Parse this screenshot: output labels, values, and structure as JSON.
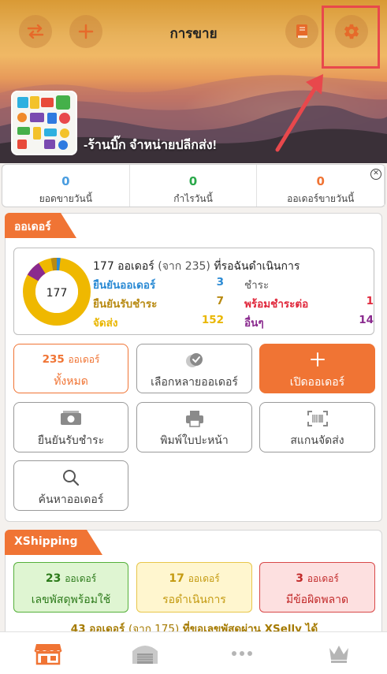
{
  "header": {
    "title": "การขาย",
    "store_name": "-ร้านบิ๊ก จำหน่ายปลีกส่ง!",
    "icons": [
      "swap-arrows-icon",
      "plus-icon",
      "book-icon",
      "gear-icon"
    ]
  },
  "stats": [
    {
      "value": "0",
      "label": "ยอดขายวันนี้",
      "color": "#4a9de0"
    },
    {
      "value": "0",
      "label": "กำไรวันนี้",
      "color": "#2aa84a"
    },
    {
      "value": "0",
      "label": "ออเดอร์ขายวันนี้",
      "color": "#f07434"
    }
  ],
  "orders": {
    "tab_label": "ออเดอร์",
    "donut_center": "177",
    "summary_count": "177 ออเดอร์",
    "summary_total": "(จาก 235)",
    "summary_suffix": "ที่รอฉันดำเนินการ",
    "rows": [
      {
        "label": "ยืนยันออเดอร์",
        "value": "3",
        "color": "#2a8ad4"
      },
      {
        "label": "ยืนยันรับชำระ",
        "value": "7",
        "color": "#b88a12"
      },
      {
        "label": "จัดส่ง",
        "value": "152",
        "color": "#e9b600"
      },
      {
        "label": "ชำระ",
        "value": "",
        "color": "#555555"
      },
      {
        "label": "พร้อมชำระต่อ",
        "value": "1",
        "color": "#e0283c"
      },
      {
        "label": "อื่นๆ",
        "value": "14",
        "color": "#8a2a8e"
      }
    ],
    "all_count": "235",
    "all_unit": "ออเดอร์",
    "all_label": "ทั้งหมด",
    "select_multi": "เลือกหลายออเดอร์",
    "open_order": "เปิดออเดอร์",
    "confirm_payment": "ยืนยันรับชำระ",
    "print_label": "พิมพ์ใบปะหน้า",
    "scan_label": "สแกนจัดส่ง",
    "search_label": "ค้นหาออเดอร์"
  },
  "xshipping": {
    "tab_label": "XShipping",
    "boxes": [
      {
        "count": "23",
        "unit": "ออเดอร์",
        "label": "เลขพัสดุพร้อมใช้",
        "bg": "#dff5d2",
        "border": "#55b03a",
        "text": "#2c7a1a"
      },
      {
        "count": "17",
        "unit": "ออเดอร์",
        "label": "รอดำเนินการ",
        "bg": "#fff6cf",
        "border": "#e8c64a",
        "text": "#c49a10"
      },
      {
        "count": "3",
        "unit": "ออเดอร์",
        "label": "มีข้อผิดพลาด",
        "bg": "#fde0e0",
        "border": "#d84848",
        "text": "#c22a2a"
      }
    ],
    "footer_count": "43 ออเดอร์",
    "footer_total": "(จาก 175)",
    "footer_suffix": "ที่ขอเลขพัสดุผ่าน XSelly ได้"
  },
  "bottom_nav": [
    "store-icon",
    "warehouse-icon",
    "more-dots-icon",
    "crown-icon"
  ],
  "colors": {
    "accent": "#f07434",
    "highlight": "#e8484c"
  }
}
